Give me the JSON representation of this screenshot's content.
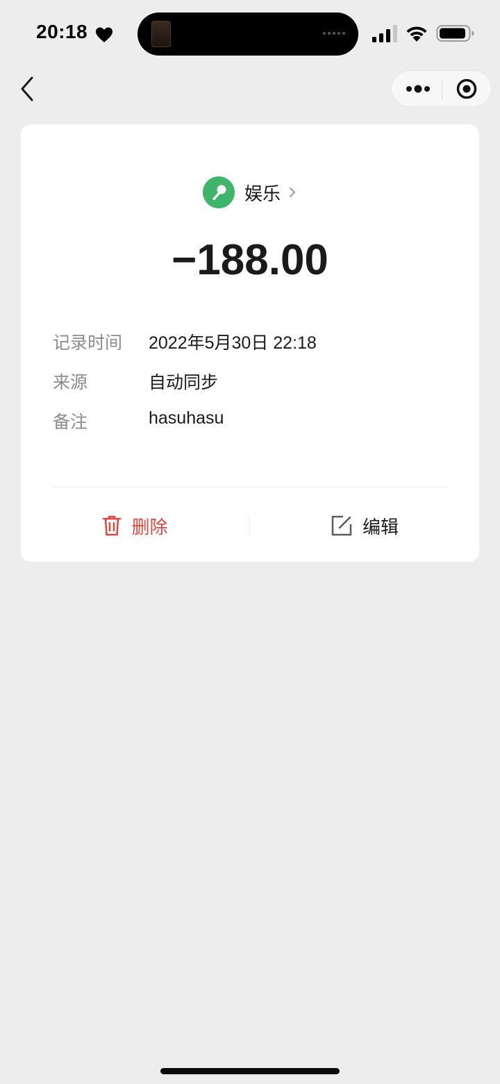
{
  "status_bar": {
    "time": "20:18"
  },
  "category": {
    "label": "娱乐",
    "color": "#3fb46b",
    "icon": "microphone-icon"
  },
  "transaction": {
    "amount": "−188.00"
  },
  "details": [
    {
      "label": "记录时间",
      "value": "2022年5月30日 22:18"
    },
    {
      "label": "来源",
      "value": "自动同步"
    },
    {
      "label": "备注",
      "value": "hasuhasu"
    }
  ],
  "actions": {
    "delete_label": "删除",
    "edit_label": "编辑",
    "delete_color": "#e0453e"
  },
  "icons": {
    "back": "chevron-left-icon",
    "more": "more-dots-icon",
    "close": "target-circle-icon",
    "delete": "trash-icon",
    "edit": "edit-icon"
  }
}
